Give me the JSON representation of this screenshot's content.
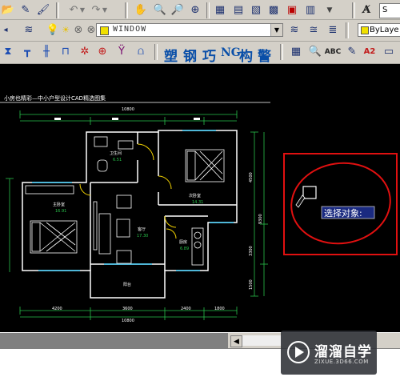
{
  "toolbar_top": {
    "icons": [
      "open-icon",
      "pencil-icon",
      "undo-icon",
      "redo-icon",
      "pan-icon",
      "zoom-realtime-icon",
      "zoom-window-icon",
      "zoom-previous-icon",
      "properties-icon",
      "design-center-icon",
      "tool-palettes-icon",
      "sheet-set-icon",
      "markup-icon",
      "calculator-icon",
      "text-style-icon"
    ],
    "right_text": "S"
  },
  "layers_bar": {
    "layer_name": "WINDOW",
    "linetype_text": "ByLaye"
  },
  "custom_toolbar": {
    "labels": [
      "塑",
      "钢",
      "巧",
      "NG",
      "构",
      "警"
    ],
    "abc_label": "ABC",
    "a2_label": "A2"
  },
  "drawing": {
    "title": "小房也精彩—中小户型设计CAD精选图集",
    "dims_top": "10800",
    "dims_bottom_total": "10800",
    "dims_bottom": [
      "4200",
      "3600",
      "2400",
      "1800"
    ],
    "dims_right": [
      "4500",
      "9300",
      "3300",
      "1500"
    ],
    "rooms": [
      {
        "name": "卫生间",
        "area": "6.51"
      },
      {
        "name": "次卧室",
        "area": "14.31"
      },
      {
        "name": "主卧室",
        "area": "16.91"
      },
      {
        "name": "客厅",
        "area": "17.30"
      },
      {
        "name": "厨房",
        "area": "6.89"
      },
      {
        "name": "阳台",
        "area": ""
      }
    ]
  },
  "selection_prompt": "选择对象:",
  "watermark": {
    "brand": "溜溜自学",
    "url": "ZIXUE.3D66.COM"
  },
  "colors": {
    "canvas": "#000000",
    "lines": "#ffffff",
    "dims": "#27c04a",
    "markup": "#e01010",
    "prompt_bg": "#1a2a80",
    "chrome": "#d4d0c8"
  }
}
